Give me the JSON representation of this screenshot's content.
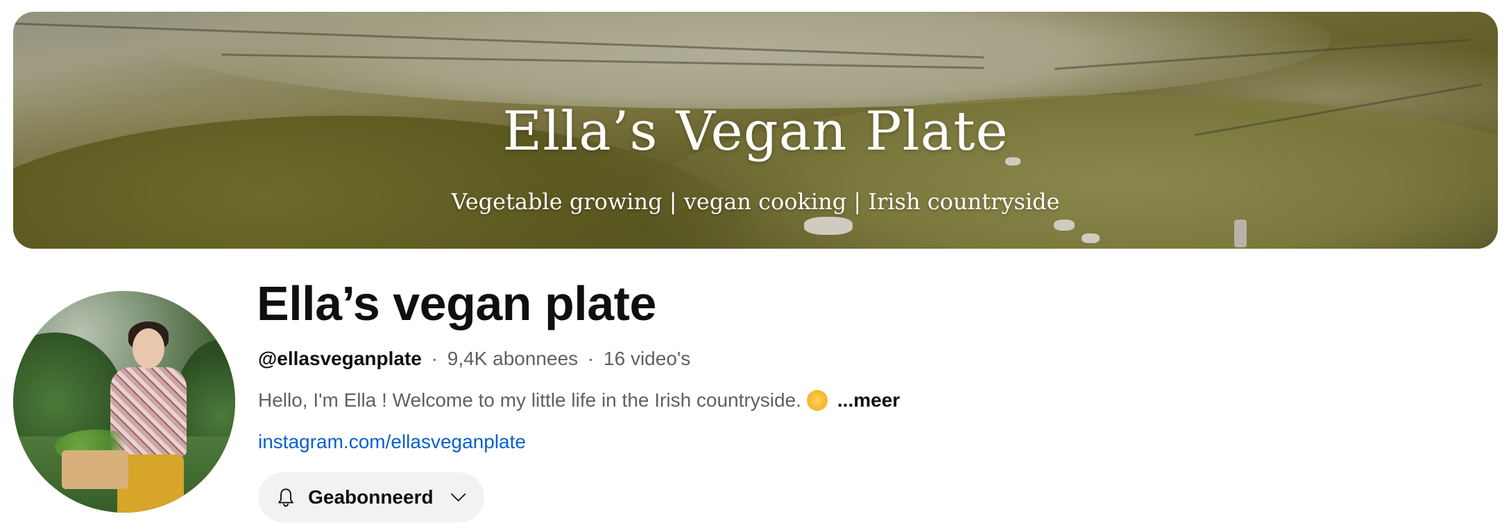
{
  "banner": {
    "title": "Ella’s Vegan Plate",
    "subtitle": "Vegetable growing | vegan cooking | Irish countryside"
  },
  "channel": {
    "name": "Ella’s vegan plate",
    "handle": "@ellasveganplate",
    "subscribers": "9,4K abonnees",
    "videos": "16 video's",
    "separator": "·",
    "description": "Hello, I'm Ella ! Welcome to my little life in the Irish countryside.",
    "description_emoji": "sun-face-icon",
    "more_label": "...meer",
    "link": "instagram.com/ellasveganplate"
  },
  "subscribe_button": {
    "label": "Geabonneerd",
    "icon": "bell-icon",
    "dropdown_icon": "chevron-down-icon",
    "background": "#f2f2f2"
  },
  "colors": {
    "link": "#065fd4",
    "secondary_text": "#606060",
    "primary_text": "#0f0f0f"
  }
}
